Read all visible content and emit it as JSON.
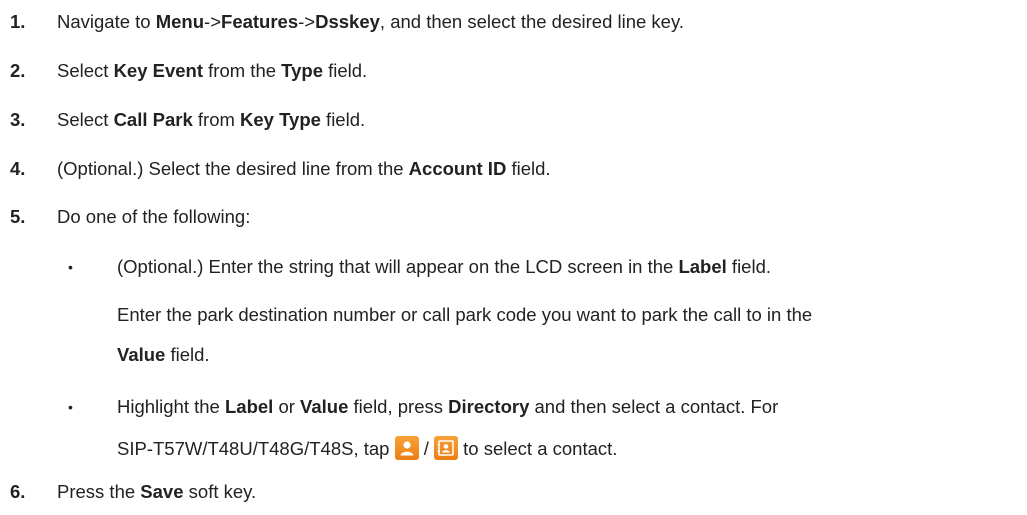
{
  "steps": [
    {
      "number": "1.",
      "parts": [
        "Navigate to ",
        "Menu",
        "->",
        "Features",
        "->",
        "Dsskey",
        ", and then select the desired line key."
      ]
    },
    {
      "number": "2.",
      "parts": [
        "Select ",
        "Key Event",
        " from the ",
        "Type",
        " field."
      ]
    },
    {
      "number": "3.",
      "parts": [
        "Select ",
        "Call Park",
        " from ",
        "Key Type",
        " field."
      ]
    },
    {
      "number": "4.",
      "parts": [
        "(Optional.) Select the desired line from the ",
        "Account ID",
        " field."
      ]
    },
    {
      "number": "5.",
      "parts": [
        "Do one of the following:"
      ]
    },
    {
      "number": "6.",
      "parts": [
        "Press the ",
        "Save",
        " soft key."
      ]
    }
  ],
  "bullets": [
    {
      "symbol": "•",
      "line1": [
        "(Optional.) Enter the string that will appear on the LCD screen in the ",
        "Label",
        " field."
      ],
      "line2": [
        "Enter the park destination number or call park code you want to park the call to in the"
      ],
      "line3": [
        "Value",
        " field."
      ]
    },
    {
      "symbol": "•",
      "line1": [
        "Highlight the ",
        "Label",
        " or ",
        "Value",
        " field, press ",
        "Directory",
        " and then select a contact. For"
      ],
      "line2": [
        "SIP-T57W/T48U/T48G/T48S, tap ",
        "/",
        " to select a contact."
      ]
    }
  ],
  "icons": {
    "contact_icon": "person-contact-icon",
    "directory_icon": "directory-book-icon",
    "accent": "#f08a24"
  }
}
